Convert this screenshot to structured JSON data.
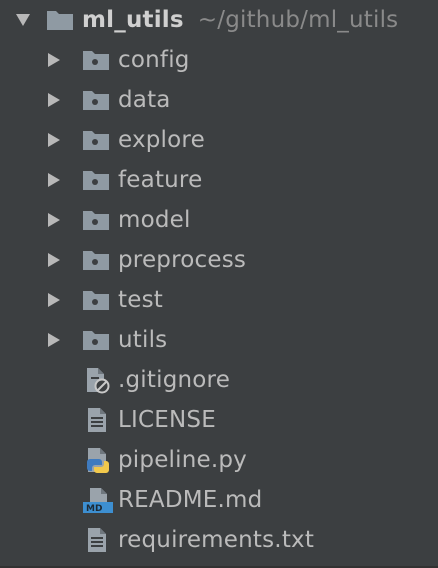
{
  "project_tree": {
    "root": {
      "name": "ml_utils",
      "path": "~/github/ml_utils",
      "expanded": true,
      "icon": "folder-icon"
    },
    "folders": [
      {
        "label": "config",
        "icon": "folder-icon",
        "expanded": false
      },
      {
        "label": "data",
        "icon": "folder-icon",
        "expanded": false
      },
      {
        "label": "explore",
        "icon": "folder-icon",
        "expanded": false
      },
      {
        "label": "feature",
        "icon": "folder-icon",
        "expanded": false
      },
      {
        "label": "model",
        "icon": "folder-icon",
        "expanded": false
      },
      {
        "label": "preprocess",
        "icon": "folder-icon",
        "expanded": false
      },
      {
        "label": "test",
        "icon": "folder-icon",
        "expanded": false
      },
      {
        "label": "utils",
        "icon": "folder-icon",
        "expanded": false
      }
    ],
    "files": [
      {
        "label": ".gitignore",
        "icon": "ignored-file-icon"
      },
      {
        "label": "LICENSE",
        "icon": "text-file-icon"
      },
      {
        "label": "pipeline.py",
        "icon": "python-file-icon"
      },
      {
        "label": "README.md",
        "icon": "markdown-file-icon"
      },
      {
        "label": "requirements.txt",
        "icon": "text-file-icon"
      }
    ]
  },
  "colors": {
    "background": "#3c3f41",
    "text": "#bbbbbb",
    "folder": "#8f9aa3",
    "python_blue": "#3f7bbf",
    "python_yellow": "#f2c94c",
    "markdown_blue": "#3d8fd1"
  }
}
